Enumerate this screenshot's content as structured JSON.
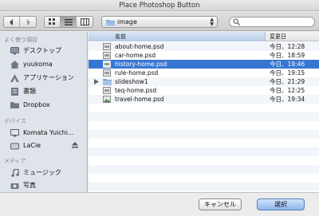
{
  "window": {
    "title": "Place Photoshop Button"
  },
  "toolbar": {
    "back_icon": "chevron-left-icon",
    "forward_icon": "chevron-right-icon",
    "views": [
      "icon-view-icon",
      "list-view-icon",
      "column-view-icon"
    ],
    "selected_view": "list-view-icon",
    "location": "image",
    "search": {
      "value": "",
      "placeholder": ""
    }
  },
  "sidebar": {
    "favorites_heading": "よく使う項目",
    "favorites": [
      {
        "label": "デスクトップ",
        "icon": "desktop-icon"
      },
      {
        "label": "yuukoma",
        "icon": "home-icon"
      },
      {
        "label": "アプリケーション",
        "icon": "applications-icon"
      },
      {
        "label": "書類",
        "icon": "documents-icon"
      },
      {
        "label": "Dropbox",
        "icon": "folder-icon"
      }
    ],
    "devices_heading": "デバイス",
    "devices": [
      {
        "label": "Komata Yuichi...",
        "icon": "computer-icon"
      },
      {
        "label": "LaCie",
        "icon": "drive-icon",
        "eject": true
      }
    ],
    "media_heading": "メディア",
    "media": [
      {
        "label": "ミュージック",
        "icon": "music-icon"
      },
      {
        "label": "写真",
        "icon": "camera-icon"
      }
    ]
  },
  "files": {
    "columns": {
      "name": "名前",
      "date": "変更日"
    },
    "rows": [
      {
        "name": "about-home.psd",
        "date": "今日、12:28",
        "kind": "psd"
      },
      {
        "name": "car-home.psd",
        "date": "今日、18:59",
        "kind": "psd"
      },
      {
        "name": "history-home.psd",
        "date": "今日、19:46",
        "kind": "psd",
        "selected": true
      },
      {
        "name": "rule-home.psd",
        "date": "今日、19:15",
        "kind": "psd"
      },
      {
        "name": "slideshow1",
        "date": "今日、21:29",
        "kind": "folder"
      },
      {
        "name": "teq-home.psd",
        "date": "今日、12:25",
        "kind": "psd"
      },
      {
        "name": "travel-home.psd",
        "date": "今日、19:34",
        "kind": "psd-image"
      }
    ]
  },
  "buttons": {
    "cancel": "キャンセル",
    "choose": "選択"
  },
  "colors": {
    "selection": "#3876d3",
    "sidebar": "#dfe4ea",
    "default_button": "#8fb6ec"
  }
}
